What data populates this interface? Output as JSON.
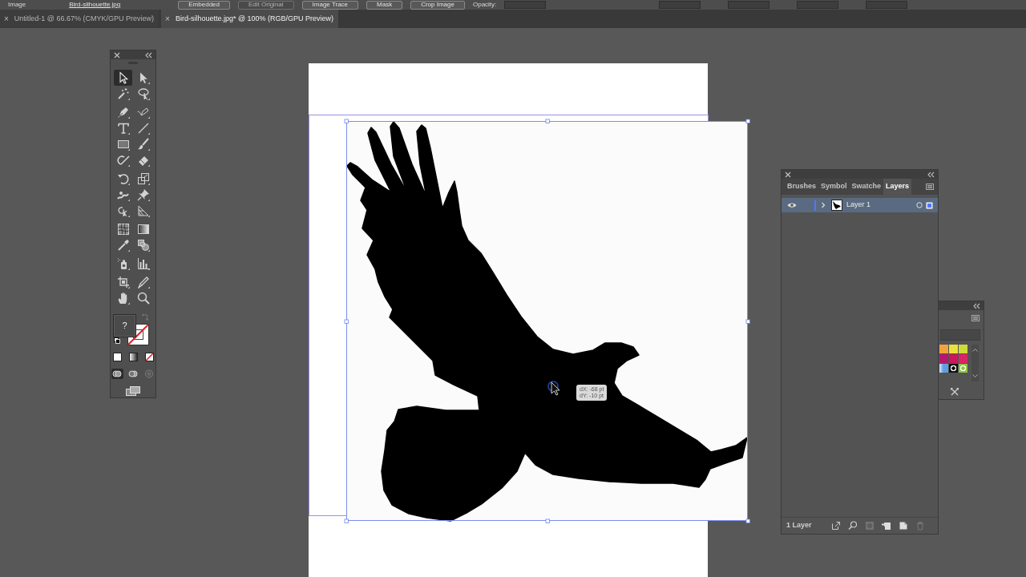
{
  "control_bar": {
    "items": [
      {
        "kind": "label",
        "text": "Image"
      },
      {
        "kind": "link",
        "text": "Bird-silhouette.jpg"
      },
      {
        "kind": "button",
        "text": "Embedded",
        "disabled": false
      },
      {
        "kind": "button",
        "text": "Edit Original",
        "disabled": true
      },
      {
        "kind": "button",
        "text": "Image Trace",
        "disabled": false
      },
      {
        "kind": "button",
        "text": "Mask",
        "disabled": false
      },
      {
        "kind": "button",
        "text": "Crop Image",
        "disabled": false
      },
      {
        "kind": "label",
        "text": "Opacity:"
      }
    ]
  },
  "document_tabs": [
    {
      "close": "×",
      "title": "Untitled-1 @ 66.67% (CMYK/GPU Preview)",
      "selected": false
    },
    {
      "close": "×",
      "title": "Bird-silhouette.jpg* @ 100% (RGB/GPU Preview)",
      "selected": true
    }
  ],
  "toolbox": {
    "tools": [
      {
        "selected": true
      },
      {
        "selected": false
      },
      {
        "selected": false
      },
      {
        "selected": false
      },
      {
        "selected": false
      },
      {
        "selected": false
      },
      {
        "selected": false
      },
      {
        "selected": false
      },
      {
        "selected": false
      },
      {
        "selected": false
      },
      {
        "selected": false
      },
      {
        "selected": false
      },
      {
        "selected": false
      },
      {
        "selected": false
      },
      {
        "selected": false
      },
      {
        "selected": false
      },
      {
        "selected": false
      },
      {
        "selected": false
      },
      {
        "selected": false
      },
      {
        "selected": false
      },
      {
        "selected": false
      },
      {
        "selected": false
      },
      {
        "selected": false
      },
      {
        "selected": false
      },
      {
        "selected": false
      },
      {
        "selected": false
      },
      {
        "selected": false
      },
      {
        "selected": false
      }
    ],
    "fill_label": "?",
    "draw_modes": [
      {
        "selected": true,
        "disabled": false
      },
      {
        "selected": false,
        "disabled": false
      },
      {
        "selected": false,
        "disabled": true
      }
    ]
  },
  "canvas": {
    "tooltip": [
      "dX: -68 pt",
      "dY: -10 pt"
    ]
  },
  "layers_panel": {
    "tabs": [
      {
        "label": "Brushes",
        "selected": false
      },
      {
        "label": "Symbol",
        "selected": false
      },
      {
        "label": "Swatche",
        "selected": false
      },
      {
        "label": "Layers",
        "selected": true
      }
    ],
    "layers": [
      {
        "name": "Layer 1",
        "visible": true,
        "expanded": false,
        "selected": true,
        "color": "#4f78ff"
      }
    ],
    "count": "1 Layer",
    "footer_buttons": [
      {
        "disabled": false
      },
      {
        "disabled": false
      },
      {
        "disabled": true
      },
      {
        "disabled": false
      },
      {
        "disabled": false
      },
      {
        "disabled": true
      }
    ]
  },
  "swatches_panel": {
    "swatches": [
      {
        "kind": "solid",
        "color": "#f2a43c"
      },
      {
        "kind": "solid",
        "color": "#ece13a"
      },
      {
        "kind": "solid",
        "color": "#cddc39"
      },
      {
        "kind": "solid",
        "color": "#b4186e"
      },
      {
        "kind": "solid",
        "color": "#c8195a"
      },
      {
        "kind": "solid",
        "color": "#dc2368"
      },
      {
        "kind": "gradient",
        "color": "#5f9ee0"
      },
      {
        "kind": "pattern",
        "color": "#111111"
      },
      {
        "kind": "pattern",
        "color": "#8cc63f"
      }
    ]
  }
}
